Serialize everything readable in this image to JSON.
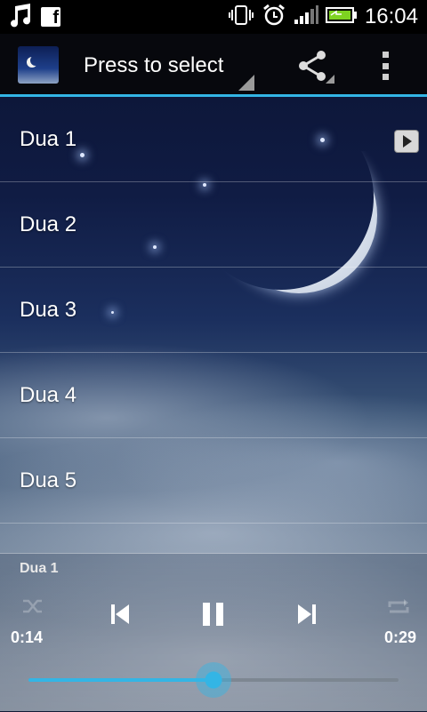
{
  "status_bar": {
    "time": "16:04",
    "icons": [
      "music-note-icon",
      "facebook-icon",
      "vibrate-icon",
      "alarm-icon",
      "signal-icon",
      "battery-charging-icon"
    ]
  },
  "action_bar": {
    "select_label": "Press to select",
    "accent_color": "#33b5e5",
    "icons": [
      "app-icon",
      "share-icon",
      "overflow-menu-icon"
    ]
  },
  "list": {
    "items": [
      {
        "label": "Dua 1",
        "playing": true
      },
      {
        "label": "Dua 2",
        "playing": false
      },
      {
        "label": "Dua 3",
        "playing": false
      },
      {
        "label": "Dua 4",
        "playing": false
      },
      {
        "label": "Dua 5",
        "playing": false
      }
    ]
  },
  "player": {
    "now_playing": "Dua 1",
    "current_time": "0:14",
    "total_time": "0:29",
    "progress": 0.5,
    "controls": [
      "shuffle-icon",
      "previous-icon",
      "pause-icon",
      "next-icon",
      "repeat-icon"
    ]
  }
}
